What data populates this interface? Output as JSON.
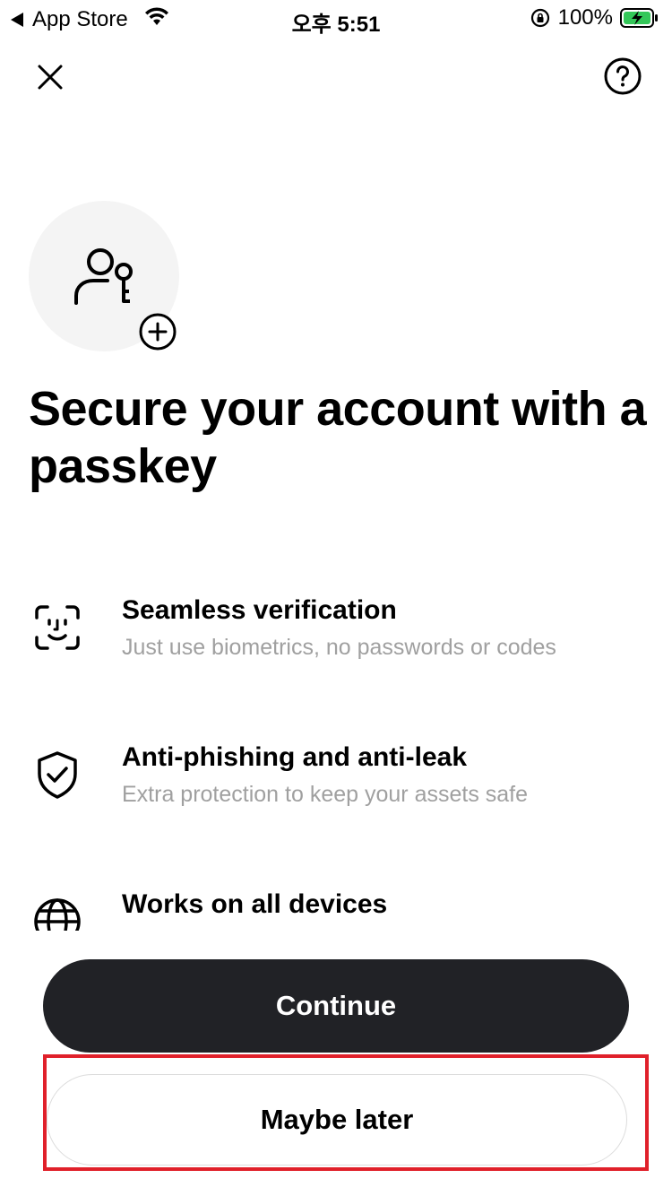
{
  "status_bar": {
    "back_label": "App Store",
    "time": "오후 5:51",
    "battery_percent": "100%"
  },
  "icons": {
    "close": "close-icon",
    "help": "question-circle-icon",
    "hero": "user-key-icon",
    "hero_badge": "plus-circle-icon",
    "feature_1": "face-id-icon",
    "feature_2": "shield-check-icon",
    "feature_3": "globe-icon"
  },
  "title": "Secure your account with a passkey",
  "features": [
    {
      "title": "Seamless verification",
      "description": "Just use biometrics, no passwords or codes"
    },
    {
      "title": "Anti-phishing and anti-leak",
      "description": "Extra protection to keep your assets safe"
    },
    {
      "title": "Works on all devices",
      "description": ""
    }
  ],
  "buttons": {
    "continue": "Continue",
    "maybe_later": "Maybe later"
  },
  "colors": {
    "primary_button": "#212226",
    "highlight": "#e0202a",
    "battery_green": "#34c759",
    "muted_text": "#a0a0a0"
  }
}
